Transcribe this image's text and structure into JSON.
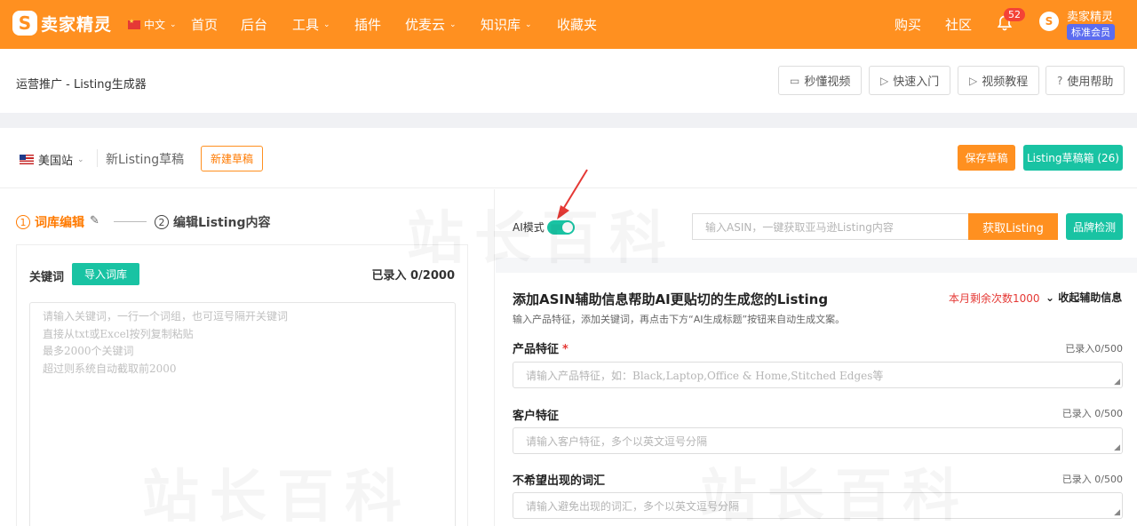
{
  "topbar": {
    "brand": "卖家精灵",
    "brand_mark": "S",
    "language": "中文",
    "nav": [
      "首页",
      "后台",
      "工具",
      "插件",
      "优麦云",
      "知识库",
      "收藏夹"
    ],
    "buy": "购买",
    "community": "社区",
    "notification_count": "52",
    "user_name": "卖家精灵",
    "membership": "标准会员",
    "color": "#ff9020"
  },
  "breadcrumb": "运营推广 - Listing生成器",
  "help": [
    "秒懂视频",
    "快速入门",
    "视频教程",
    "使用帮助"
  ],
  "draft_bar": {
    "site": "美国站",
    "draft_name": "新Listing草稿",
    "new_draft": "新建草稿",
    "save_draft": "保存草稿",
    "draft_box": "Listing草稿箱 (26)"
  },
  "steps": {
    "step1_num": "1",
    "step1": "词库编辑",
    "step2_num": "2",
    "step2": "编辑Listing内容"
  },
  "keywords": {
    "label": "关键词",
    "import": "导入词库",
    "count": "已录入 0/2000",
    "placeholder": [
      "请输入关键词，一行一个词组，也可逗号隔开关键词",
      "直接从txt或Excel按列复制粘贴",
      "最多2000个关键词",
      "超过则系统自动截取前2000"
    ]
  },
  "ai": {
    "mode_label": "AI模式",
    "mode_on": true,
    "asin_placeholder": "输入ASIN，一键获取亚马逊Listing内容",
    "get_listing": "获取Listing",
    "brand_check": "品牌检测"
  },
  "assist": {
    "title": "添加ASIN辅助信息帮助AI更贴切的生成您的Listing",
    "subtitle": "输入产品特征，添加关键词，再点击下方“AI生成标题”按钮来自动生成文案。",
    "quota": "本月剩余次数1000",
    "collapse": "收起辅助信息",
    "fields": [
      {
        "label": "产品特征",
        "required": true,
        "count": "已录入0/500",
        "placeholder": "请输入产品特征，如：Black,Laptop,Office & Home,Stitched Edges等"
      },
      {
        "label": "客户特征",
        "required": false,
        "count": "已录入 0/500",
        "placeholder": "请输入客户特征，多个以英文逗号分隔"
      },
      {
        "label": "不希望出现的词汇",
        "required": false,
        "count": "已录入 0/500",
        "placeholder": "请输入避免出现的词汇，多个以英文逗号分隔"
      }
    ]
  },
  "watermark": "站长百科",
  "colors": {
    "accent": "#ff9020",
    "teal": "#19c3a3",
    "red": "#e53935"
  }
}
